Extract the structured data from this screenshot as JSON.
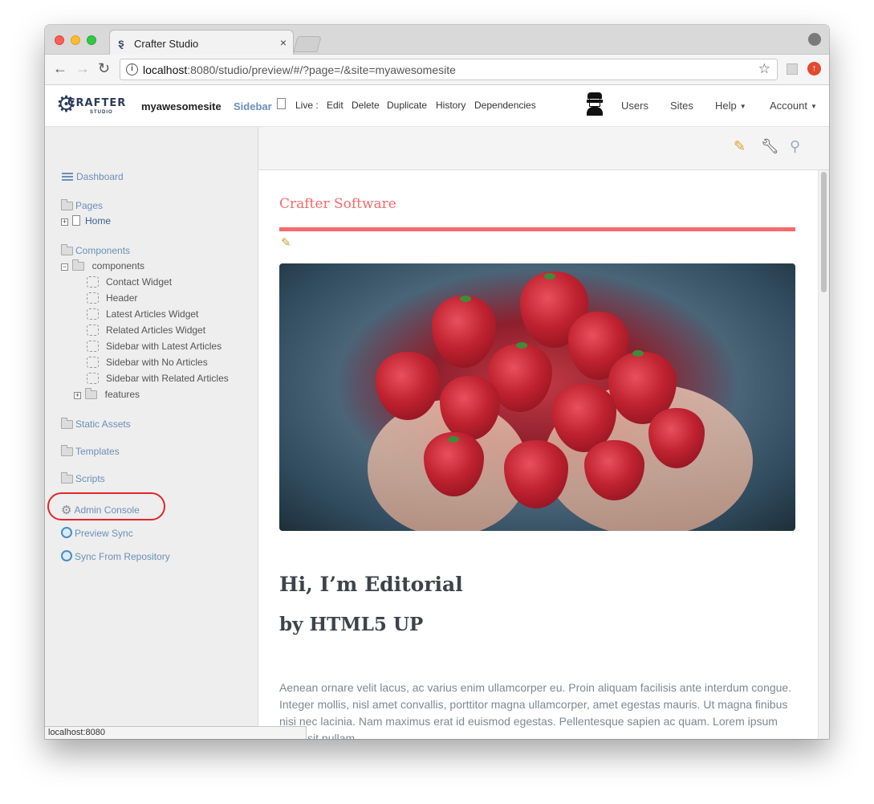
{
  "browser": {
    "tab_title": "Crafter Studio",
    "tab_close": "×",
    "url_host": "localhost",
    "url_rest": ":8080/studio/preview/#/?page=/&site=myawesomesite",
    "status_url": "localhost:8080"
  },
  "toolbar": {
    "logo_text": "CRAFTER",
    "logo_sub": "STUDIO",
    "site_name": "myawesomesite",
    "sidebar_label": "Sidebar",
    "live_label": "Live :",
    "actions": [
      "Edit",
      "Delete",
      "Duplicate",
      "History",
      "Dependencies"
    ],
    "users_label": "Users",
    "sites_label": "Sites",
    "help_label": "Help",
    "account_label": "Account"
  },
  "sidebar": {
    "dashboard": "Dashboard",
    "pages": "Pages",
    "home": "Home",
    "components": "Components",
    "components_folder": "components",
    "component_items": [
      "Contact Widget",
      "Header",
      "Latest Articles Widget",
      "Related Articles Widget",
      "Sidebar with Latest Articles",
      "Sidebar with No Articles",
      "Sidebar with Related Articles"
    ],
    "features_folder": "features",
    "static_assets": "Static Assets",
    "templates": "Templates",
    "scripts": "Scripts",
    "admin_console": "Admin Console",
    "preview_sync": "Preview Sync",
    "sync_from_repo": "Sync From Repository"
  },
  "preview": {
    "site_title": "Crafter Software",
    "heading_1": "Hi, I’m Editorial",
    "heading_2": "by HTML5 UP",
    "body": "Aenean ornare velit lacus, ac varius enim ullamcorper eu. Proin aliquam facilisis ante interdum congue. Integer mollis, nisl amet convallis, porttitor magna ullamcorper, amet egestas mauris. Ut magna finibus nisi nec lacinia. Nam maximus erat id euismod egestas. Pellentesque sapien ac quam. Lorem ipsum dolor sit nullam."
  },
  "colors": {
    "accent": "#f56a6a",
    "link": "#6a8fb9",
    "highlight_ring": "#e0262b"
  }
}
